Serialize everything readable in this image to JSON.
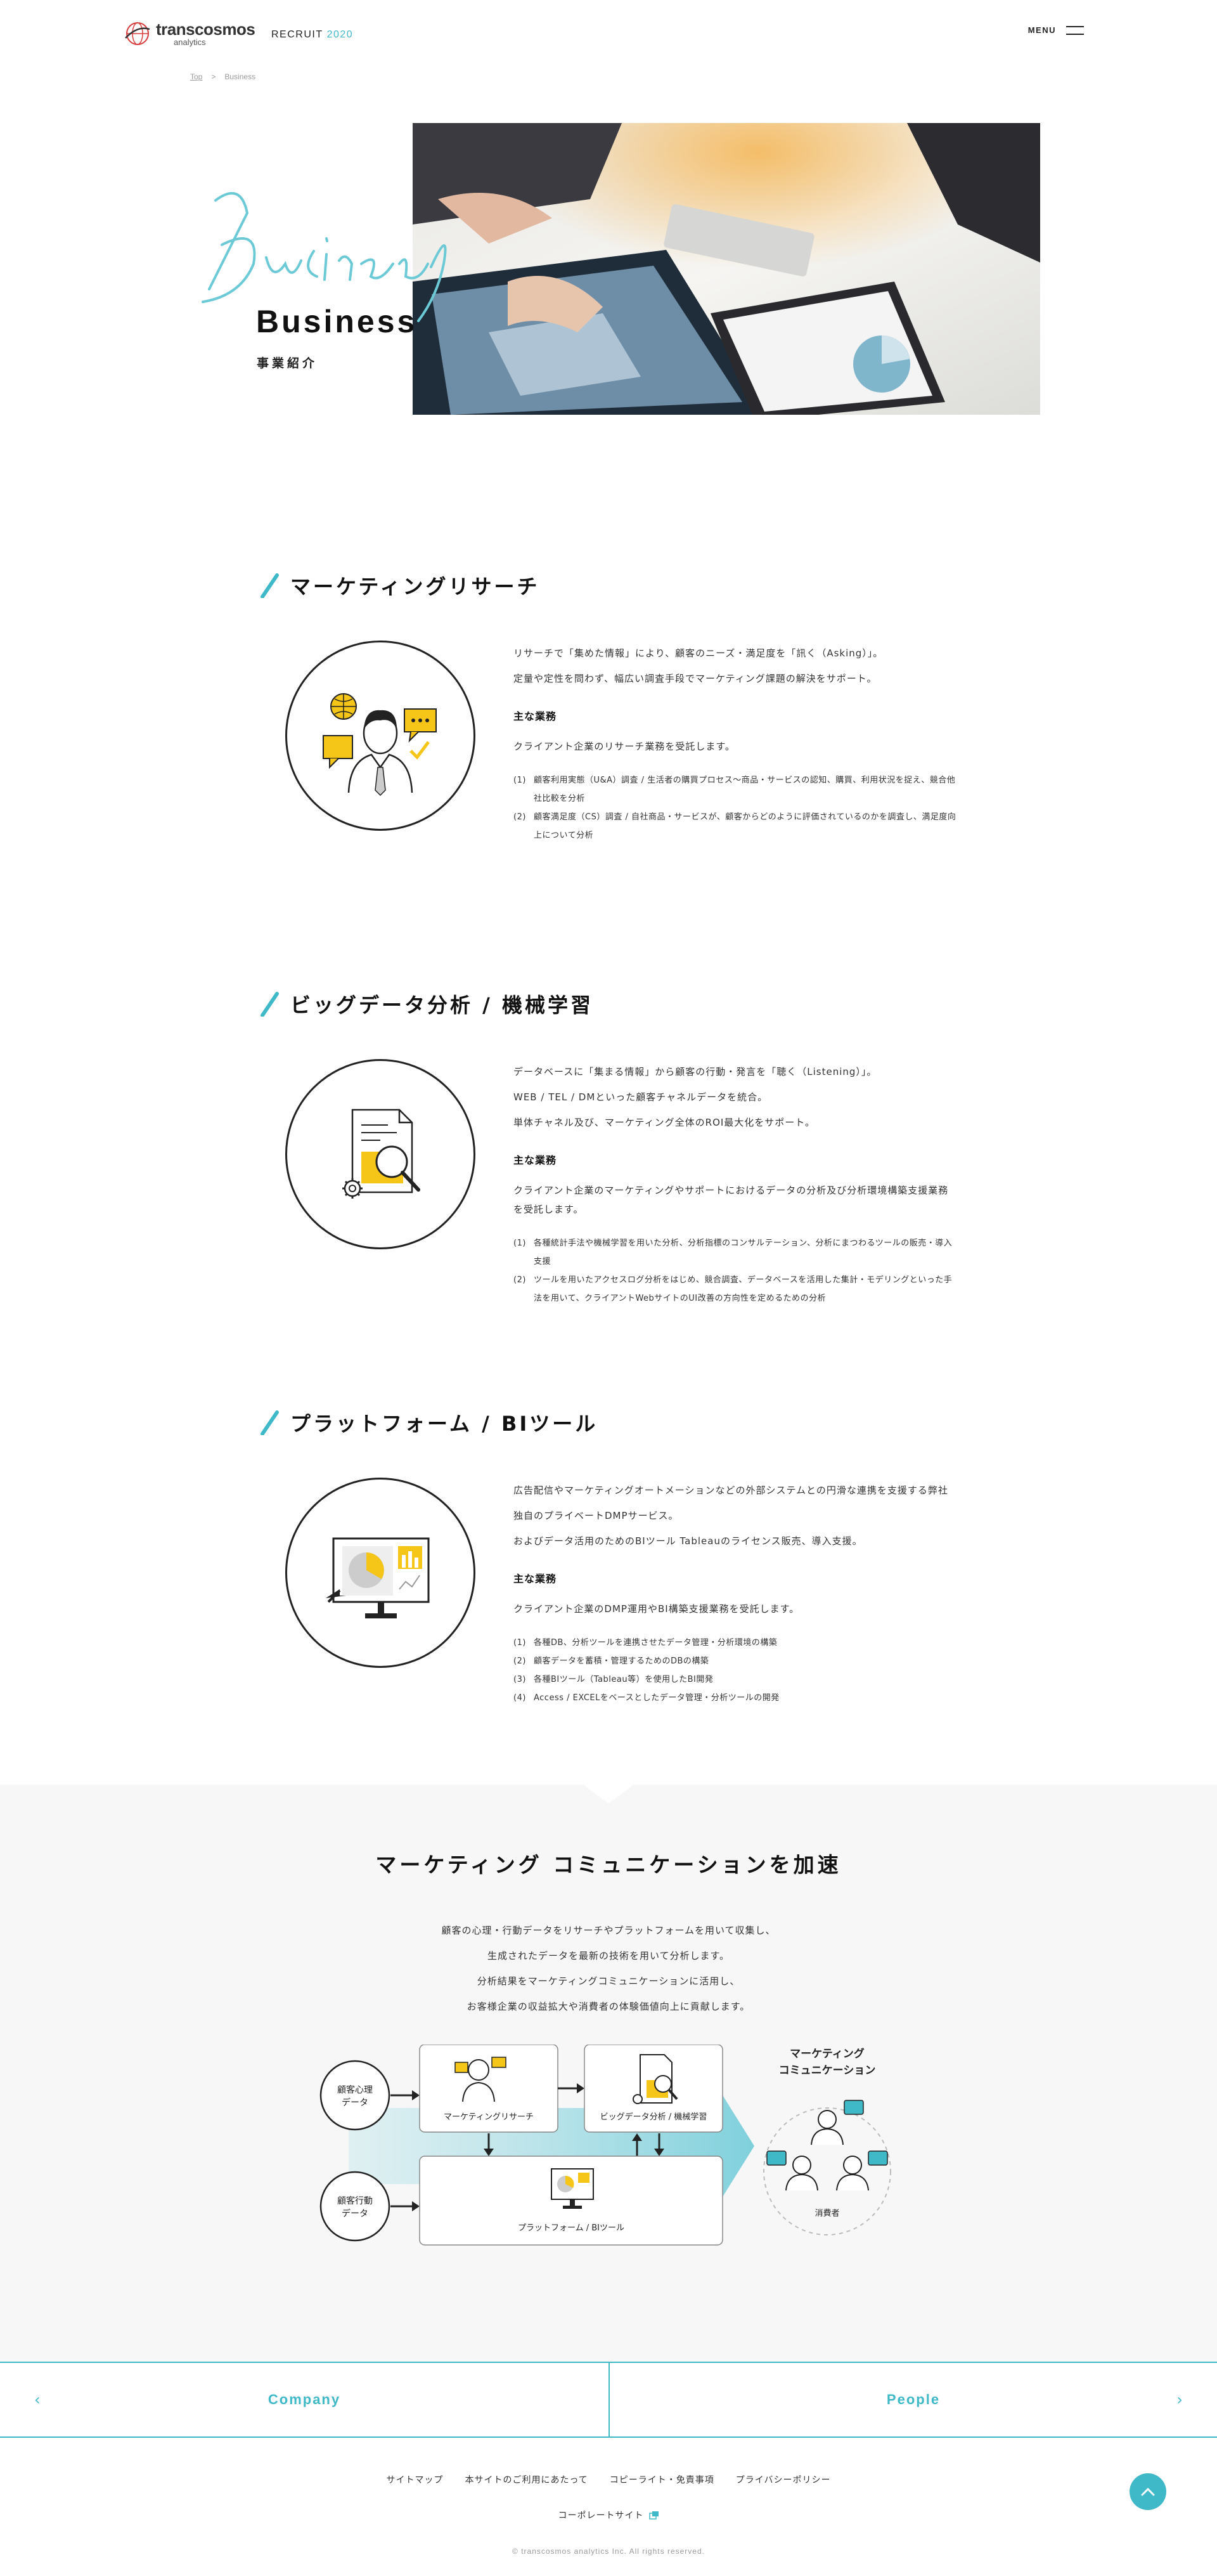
{
  "header": {
    "logo_name": "transcosmos",
    "logo_sub": "analytics",
    "recruit_label": "RECRUIT",
    "recruit_year": "2020",
    "menu_label": "MENU"
  },
  "breadcrumb": {
    "home": "Top",
    "separator": ">",
    "current": "Business"
  },
  "hero": {
    "script_word": "Business",
    "title": "Business",
    "subtitle": "事業紹介"
  },
  "sections": [
    {
      "title": "マーケティングリサーチ",
      "lead": [
        "リサーチで「集めた情報」により、顧客のニーズ・満足度を「訊く（Asking）」。",
        "定量や定性を問わず、幅広い調査手段でマーケティング課題の解決をサポート。"
      ],
      "sub_heading": "主な業務",
      "desc": "クライアント企業のリサーチ業務を受託します。",
      "items": [
        {
          "num": "(1)",
          "text": "顧客利用実態（U&A）調査 / 生活者の購買プロセス～商品・サービスの認知、購買、利用状況を捉え、競合他社比較を分析"
        },
        {
          "num": "(2)",
          "text": "顧客満足度（CS）調査 / 自社商品・サービスが、顧客からどのように評価されているのかを調査し、満足度向上について分析"
        }
      ]
    },
    {
      "title": "ビッグデータ分析 / 機械学習",
      "lead": [
        "データベースに「集まる情報」から顧客の行動・発言を「聴く（Listening）」。",
        "WEB / TEL / DMといった顧客チャネルデータを統合。",
        "単体チャネル及び、マーケティング全体のROI最大化をサポート。"
      ],
      "sub_heading": "主な業務",
      "desc": "クライアント企業のマーケティングやサポートにおけるデータの分析及び分析環境構築支援業務を受託します。",
      "items": [
        {
          "num": "(1)",
          "text": "各種統計手法や機械学習を用いた分析、分析指標のコンサルテーション、分析にまつわるツールの販売・導入支援"
        },
        {
          "num": "(2)",
          "text": "ツールを用いたアクセスログ分析をはじめ、競合調査、データベースを活用した集計・モデリングといった手法を用いて、クライアントWebサイトのUI改善の方向性を定めるための分析"
        }
      ]
    },
    {
      "title": "プラットフォーム / BIツール",
      "lead": [
        "広告配信やマーケティングオートメーションなどの外部システムとの円滑な連携を支援する弊社独自のプライベートDMPサービス。",
        "およびデータ活用のためのBIツール Tableauのライセンス販売、導入支援。"
      ],
      "sub_heading": "主な業務",
      "desc": "クライアント企業のDMP運用やBI構築支援業務を受託します。",
      "items": [
        {
          "num": "(1)",
          "text": "各種DB、分析ツールを連携させたデータ管理・分析環境の構築"
        },
        {
          "num": "(2)",
          "text": "顧客データを蓄積・管理するためのDBの構築"
        },
        {
          "num": "(3)",
          "text": "各種BIツール（Tableau等）を使用したBI開発"
        },
        {
          "num": "(4)",
          "text": "Access / EXCELをベースとしたデータ管理・分析ツールの開発"
        }
      ]
    }
  ],
  "accel": {
    "title": "マーケティング コミュニケーションを加速",
    "lead": [
      "顧客の心理・行動データをリサーチやプラットフォームを用いて収集し、",
      "生成されたデータを最新の技術を用いて分析します。",
      "分析結果をマーケティングコミュニケーションに活用し、",
      "お客様企業の収益拡大や消費者の体験価値向上に貢献します。"
    ],
    "diagram": {
      "input_psych": [
        "顧客心理",
        "データ"
      ],
      "input_behavior": [
        "顧客行動",
        "データ"
      ],
      "box_research": "マーケティングリサーチ",
      "box_bigdata": "ビッグデータ分析 / 機械学習",
      "box_platform": "プラットフォーム / BIツール",
      "output_title": [
        "マーケティング",
        "コミュニケーション"
      ],
      "consumer": "消費者"
    }
  },
  "pager": {
    "prev": "Company",
    "next": "People"
  },
  "footer": {
    "links": [
      "サイトマップ",
      "本サイトのご利用にあたって",
      "コピーライト・免責事項",
      "プライバシーポリシー"
    ],
    "corporate": "コーポレートサイト",
    "copyright": "© transcosmos analytics Inc. All rights reserved."
  },
  "colors": {
    "accent": "#3fb8c8",
    "yellow": "#f5c518",
    "dark": "#222222"
  }
}
